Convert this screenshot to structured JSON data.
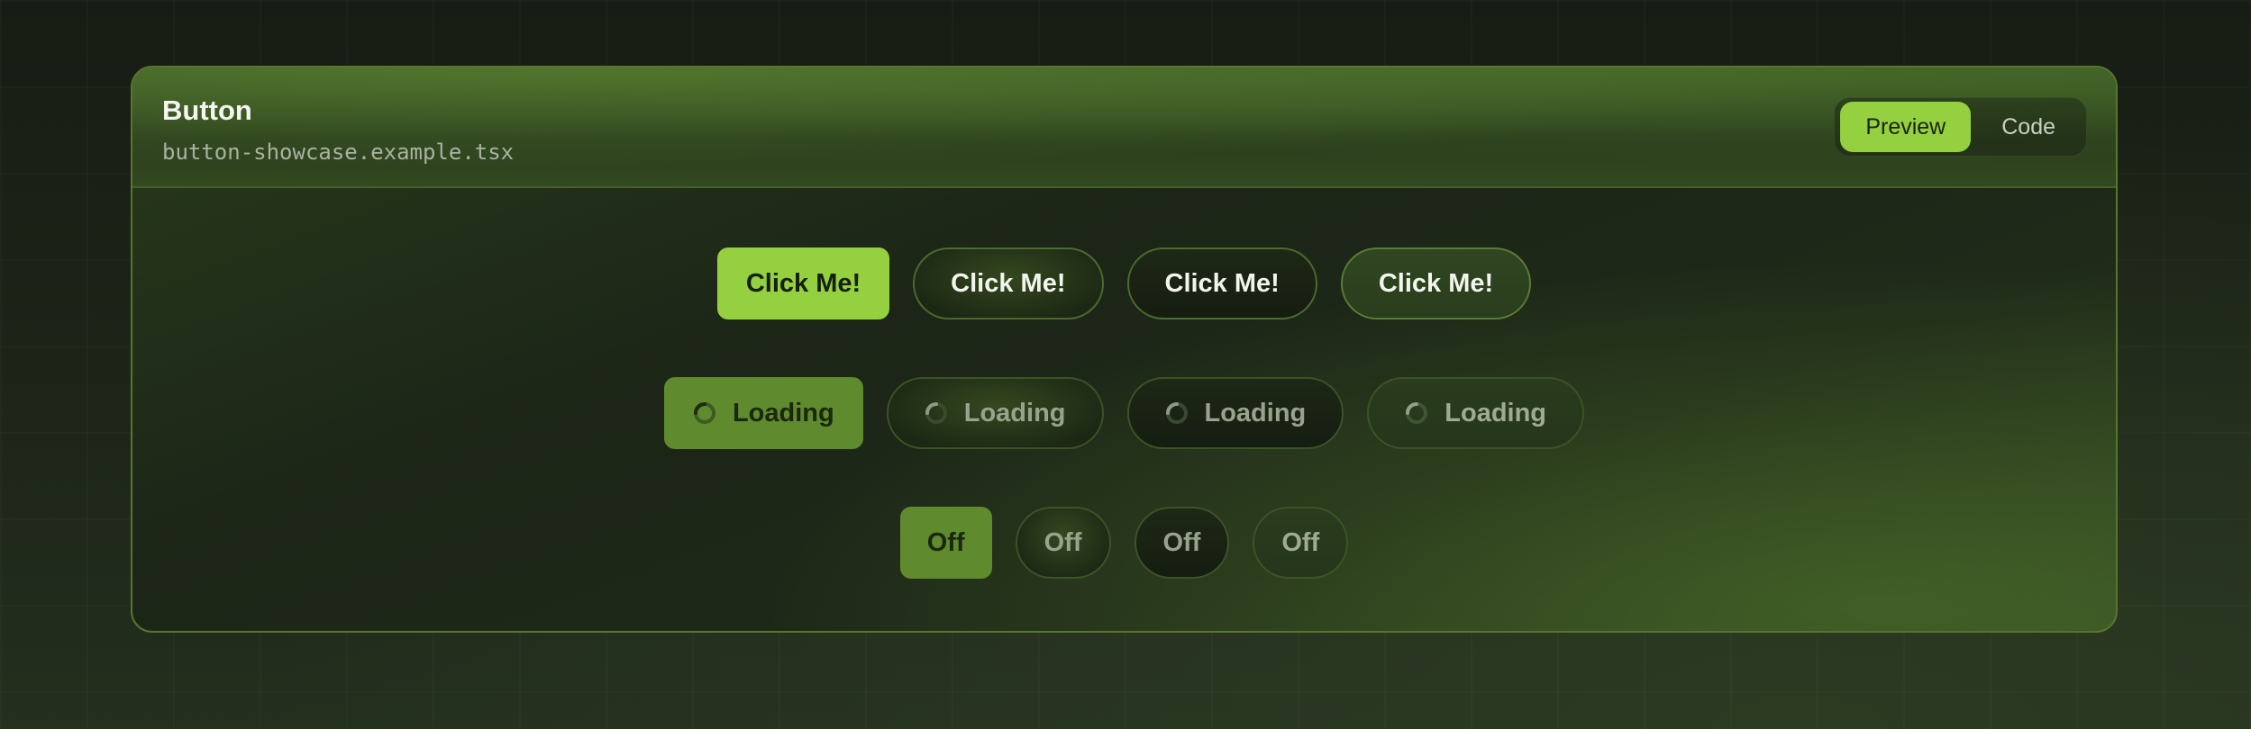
{
  "card": {
    "title": "Button",
    "subtitle": "button-showcase.example.tsx"
  },
  "tabs": [
    {
      "label": "Preview",
      "active": true
    },
    {
      "label": "Code",
      "active": false
    }
  ],
  "rows": {
    "click": [
      "Click Me!",
      "Click Me!",
      "Click Me!",
      "Click Me!"
    ],
    "loading": [
      "Loading",
      "Loading",
      "Loading",
      "Loading"
    ],
    "off": [
      "Off",
      "Off",
      "Off",
      "Off"
    ]
  },
  "colors": {
    "accent": "#94d040",
    "border": "#58752d"
  }
}
